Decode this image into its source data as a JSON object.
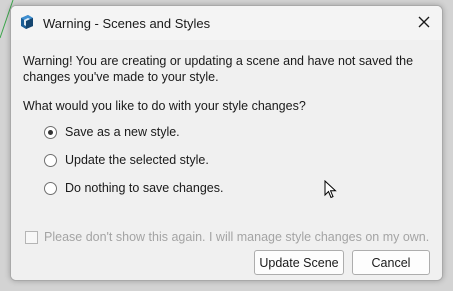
{
  "dialog": {
    "title": "Warning - Scenes and Styles",
    "app_icon": "sketchup-icon",
    "close_icon": "close-icon"
  },
  "message": {
    "warning": "Warning! You are creating or updating a scene and have not saved the changes you've made to your style.",
    "question": "What would you like to do with your style changes?"
  },
  "options": [
    {
      "label": "Save as a new style.",
      "selected": true
    },
    {
      "label": "Update the selected style.",
      "selected": false
    },
    {
      "label": "Do nothing to save changes.",
      "selected": false
    }
  ],
  "dont_show": {
    "label": "Please don't show this again.  I will manage style changes on my own.",
    "checked": false,
    "disabled": true
  },
  "buttons": {
    "update_scene": "Update Scene",
    "cancel": "Cancel"
  }
}
